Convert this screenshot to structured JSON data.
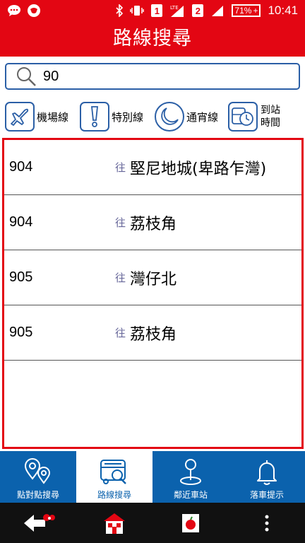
{
  "status_bar": {
    "time": "10:41",
    "battery": "71%",
    "sim1": "1",
    "sim2": "2",
    "network": "LTE"
  },
  "header": {
    "title": "路線搜尋"
  },
  "search": {
    "value": "90",
    "placeholder": ""
  },
  "filters": [
    {
      "label": "機場線",
      "icon": "airplane-icon"
    },
    {
      "label": "特別線",
      "icon": "exclamation-icon"
    },
    {
      "label": "通宵線",
      "icon": "moon-icon"
    },
    {
      "label_line1": "到站",
      "label_line2": "時間",
      "icon": "bus-clock-icon"
    }
  ],
  "results": [
    {
      "route": "904",
      "direction": "往",
      "destination": "堅尼地城(卑路乍灣)"
    },
    {
      "route": "904",
      "direction": "往",
      "destination": "荔枝角"
    },
    {
      "route": "905",
      "direction": "往",
      "destination": "灣仔北"
    },
    {
      "route": "905",
      "direction": "往",
      "destination": "荔枝角"
    }
  ],
  "tabs": [
    {
      "label": "點對點搜尋",
      "icon": "map-pins-icon"
    },
    {
      "label": "路線搜尋",
      "icon": "bus-search-icon"
    },
    {
      "label": "鄰近車站",
      "icon": "location-pin-icon"
    },
    {
      "label": "落車提示",
      "icon": "bell-icon"
    }
  ],
  "colors": {
    "brand_red": "#e30613",
    "brand_blue": "#0b62ad",
    "accent_blue": "#2b5fa6"
  }
}
